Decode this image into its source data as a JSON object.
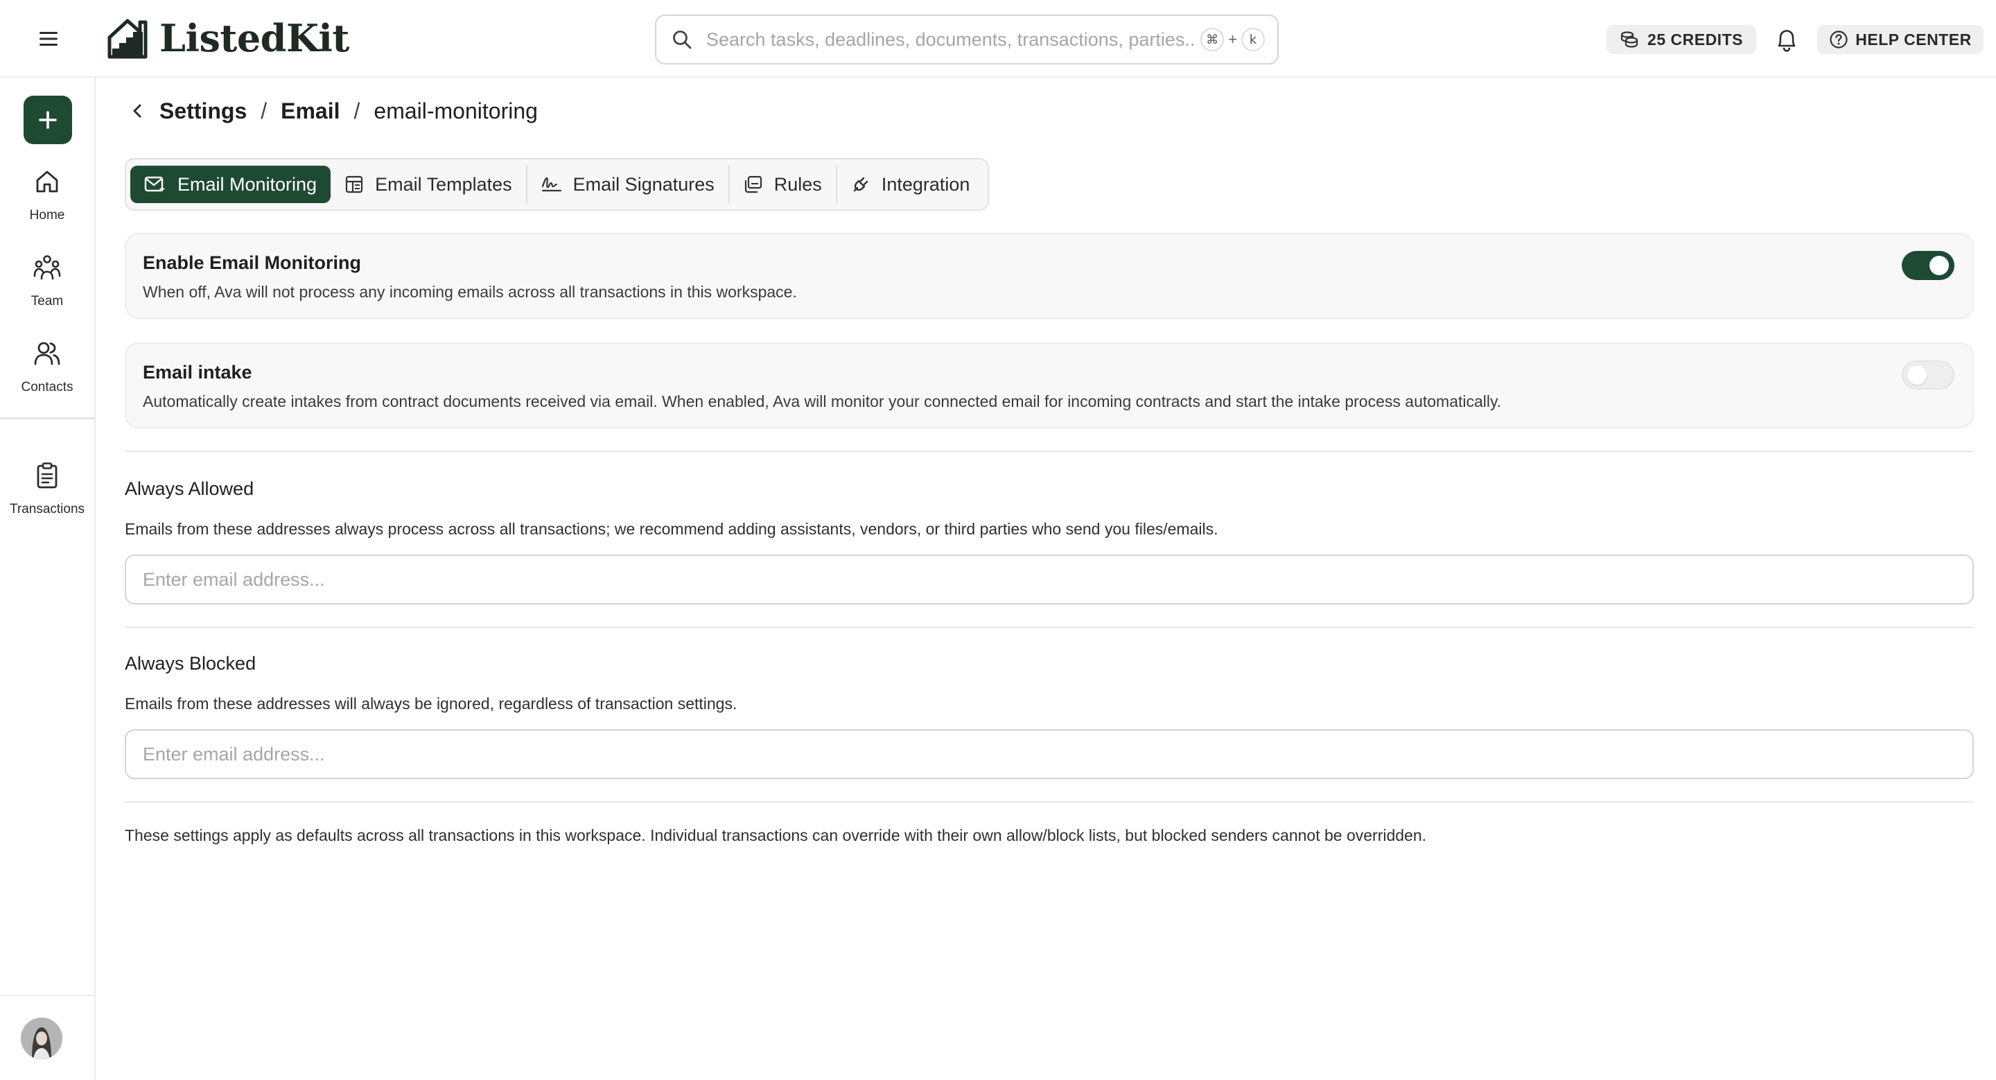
{
  "header": {
    "logo_text": "ListedKit",
    "search": {
      "placeholder": "Search tasks, deadlines, documents, transactions, parties..",
      "shortcut_mod": "⌘",
      "shortcut_plus": "+",
      "shortcut_key": "k"
    },
    "credits_label": "25 CREDITS",
    "help_label": "HELP CENTER"
  },
  "sidebar": {
    "items": [
      {
        "label": "Home",
        "icon": "home-icon"
      },
      {
        "label": "Team",
        "icon": "team-icon"
      },
      {
        "label": "Contacts",
        "icon": "contacts-icon"
      },
      {
        "label": "Transactions",
        "icon": "clipboard-icon"
      }
    ]
  },
  "breadcrumb": {
    "settings": "Settings",
    "email": "Email",
    "current": "email-monitoring",
    "sep": "/"
  },
  "tabs": [
    {
      "label": "Email Monitoring",
      "active": true
    },
    {
      "label": "Email Templates",
      "active": false
    },
    {
      "label": "Email Signatures",
      "active": false
    },
    {
      "label": "Rules",
      "active": false
    },
    {
      "label": "Integration",
      "active": false
    }
  ],
  "monitoring": {
    "title": "Enable Email Monitoring",
    "desc": "When off, Ava will not process any incoming emails across all transactions in this workspace.",
    "enabled": true
  },
  "intake": {
    "title": "Email intake",
    "desc": "Automatically create intakes from contract documents received via email. When enabled, Ava will monitor your connected email for incoming contracts and start the intake process automatically.",
    "enabled": false
  },
  "allowed": {
    "title": "Always Allowed",
    "desc": "Emails from these addresses always process across all transactions; we recommend adding assistants, vendors, or third parties who send you files/emails.",
    "placeholder": "Enter email address..."
  },
  "blocked": {
    "title": "Always Blocked",
    "desc": "Emails from these addresses will always be ignored, regardless of transaction settings.",
    "placeholder": "Enter email address..."
  },
  "footer_note": "These settings apply as defaults across all transactions in this workspace. Individual transactions can override with their own allow/block lists, but blocked senders cannot be overridden.",
  "colors": {
    "accent": "#1e4a34",
    "border": "#ececec",
    "card_bg": "#f8f8f8"
  }
}
